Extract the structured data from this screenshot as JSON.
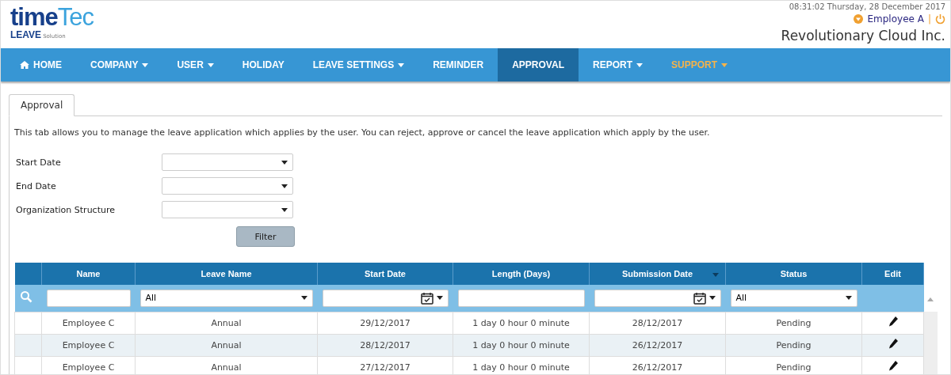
{
  "header": {
    "logo": {
      "word_1": "time",
      "word_2": "Tec",
      "product": "LEAVE",
      "suffix": "Solution"
    },
    "datetime": "08:31:02 Thursday, 28 December 2017",
    "user": "Employee A",
    "separator": "|",
    "company": "Revolutionary Cloud Inc."
  },
  "nav": [
    {
      "label": "HOME",
      "kind": "home",
      "selected": false,
      "highlighted": false
    },
    {
      "label": "COMPANY",
      "kind": "dropdown",
      "selected": false,
      "highlighted": false
    },
    {
      "label": "USER",
      "kind": "dropdown",
      "selected": false,
      "highlighted": false
    },
    {
      "label": "HOLIDAY",
      "kind": "plain",
      "selected": false,
      "highlighted": false
    },
    {
      "label": "LEAVE SETTINGS",
      "kind": "dropdown",
      "selected": false,
      "highlighted": false
    },
    {
      "label": "REMINDER",
      "kind": "plain",
      "selected": false,
      "highlighted": false
    },
    {
      "label": "APPROVAL",
      "kind": "plain",
      "selected": true,
      "highlighted": false
    },
    {
      "label": "REPORT",
      "kind": "dropdown",
      "selected": false,
      "highlighted": false
    },
    {
      "label": "SUPPORT",
      "kind": "dropdown",
      "selected": false,
      "highlighted": true
    }
  ],
  "tabs": [
    {
      "label": "Approval",
      "selected": true
    }
  ],
  "description": "This tab allows you to manage the leave application which applies by the user. You can reject, approve or cancel the leave application which apply by the user.",
  "form": {
    "fields": [
      {
        "label": "Start Date"
      },
      {
        "label": "End Date"
      },
      {
        "label": "Organization Structure"
      }
    ],
    "button": "Filter"
  },
  "table": {
    "columns": [
      {
        "sorted": false
      },
      {
        "label": "Name",
        "sorted": false
      },
      {
        "label": "Leave Name",
        "sorted": false
      },
      {
        "label": "Start Date",
        "sorted": false
      },
      {
        "label": "Length (Days)",
        "sorted": false
      },
      {
        "label": "Submission Date",
        "sorted": true
      },
      {
        "label": "Status",
        "sorted": false
      },
      {
        "label": "Edit",
        "sorted": false
      }
    ],
    "filters": [
      {
        "kind": "search"
      },
      {
        "kind": "text"
      },
      {
        "kind": "select",
        "value": "All"
      },
      {
        "kind": "date"
      },
      {
        "kind": "text"
      },
      {
        "kind": "date"
      },
      {
        "kind": "select",
        "value": "All"
      },
      {
        "kind": "none"
      }
    ],
    "rows": [
      {
        "cells": [
          "",
          "Employee C",
          "Annual",
          "29/12/2017",
          "1 day 0 hour 0 minute",
          "28/12/2017",
          "Pending",
          ""
        ]
      },
      {
        "cells": [
          "",
          "Employee C",
          "Annual",
          "28/12/2017",
          "1 day 0 hour 0 minute",
          "26/12/2017",
          "Pending",
          ""
        ]
      },
      {
        "cells": [
          "",
          "Employee C",
          "Annual",
          "27/12/2017",
          "1 day 0 hour 0 minute",
          "26/12/2017",
          "Pending",
          ""
        ]
      }
    ]
  }
}
